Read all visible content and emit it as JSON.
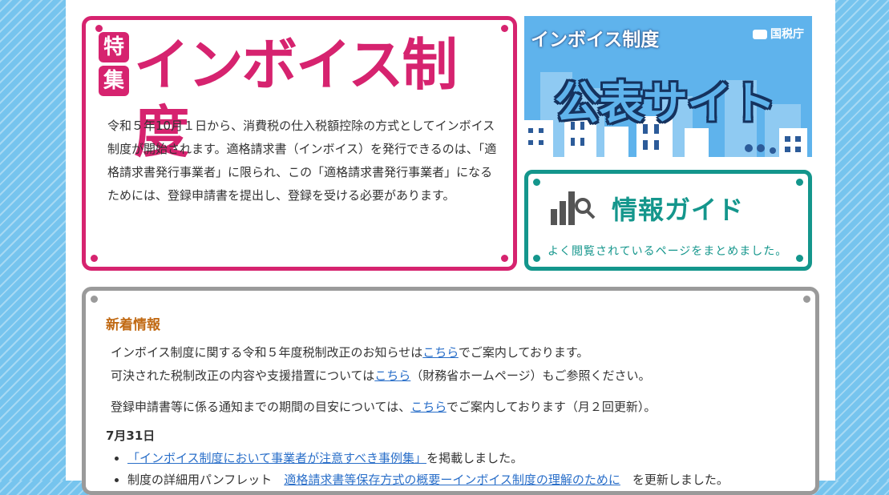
{
  "feature": {
    "badge1": "特",
    "badge2": "集",
    "title": "インボイス制度",
    "description": "令和５年10月１日から、消費税の仕入税額控除の方式としてインボイス制度が開始されます。適格請求書（インボイス）を発行できるのは、「適格請求書発行事業者」に限られ、この「適格請求書発行事業者」になるためには、登録申請書を提出し、登録を受ける必要があります。"
  },
  "banner": {
    "top_label": "インボイス制度",
    "logo": "国税庁",
    "main_label": "公表サイト"
  },
  "guide": {
    "title": "情報ガイド",
    "description": "よく閲覧されているページをまとめました。",
    "icon": "chart-search-icon"
  },
  "news": {
    "heading": "新着情報",
    "line1_before": "インボイス制度に関する令和５年度税制改正のお知らせは",
    "line1_link": "こちら",
    "line1_after": "でご案内しております。",
    "line2_before": "可決された税制改正の内容や支援措置については",
    "line2_link": "こちら",
    "line2_after": "（財務省ホームページ）もご参照ください。",
    "line3_before": "登録申請書等に係る通知までの期間の目安については、",
    "line3_link": "こちら",
    "line3_after": "でご案内しております（月２回更新）。",
    "date": "7月31日",
    "items": [
      {
        "link": "「インボイス制度において事業者が注意すべき事例集」",
        "after": "を掲載しました。"
      },
      {
        "before": "制度の詳細用パンフレット　",
        "link": "適格請求書等保存方式の概要ーインボイス制度の理解のために",
        "after": "　を更新しました。"
      }
    ]
  },
  "colors": {
    "feature": "#d6236f",
    "guide": "#14968c",
    "news_border": "#9a9a9a",
    "news_heading": "#c16a14",
    "link": "#2a6fc9",
    "background": "#76c4ee"
  }
}
